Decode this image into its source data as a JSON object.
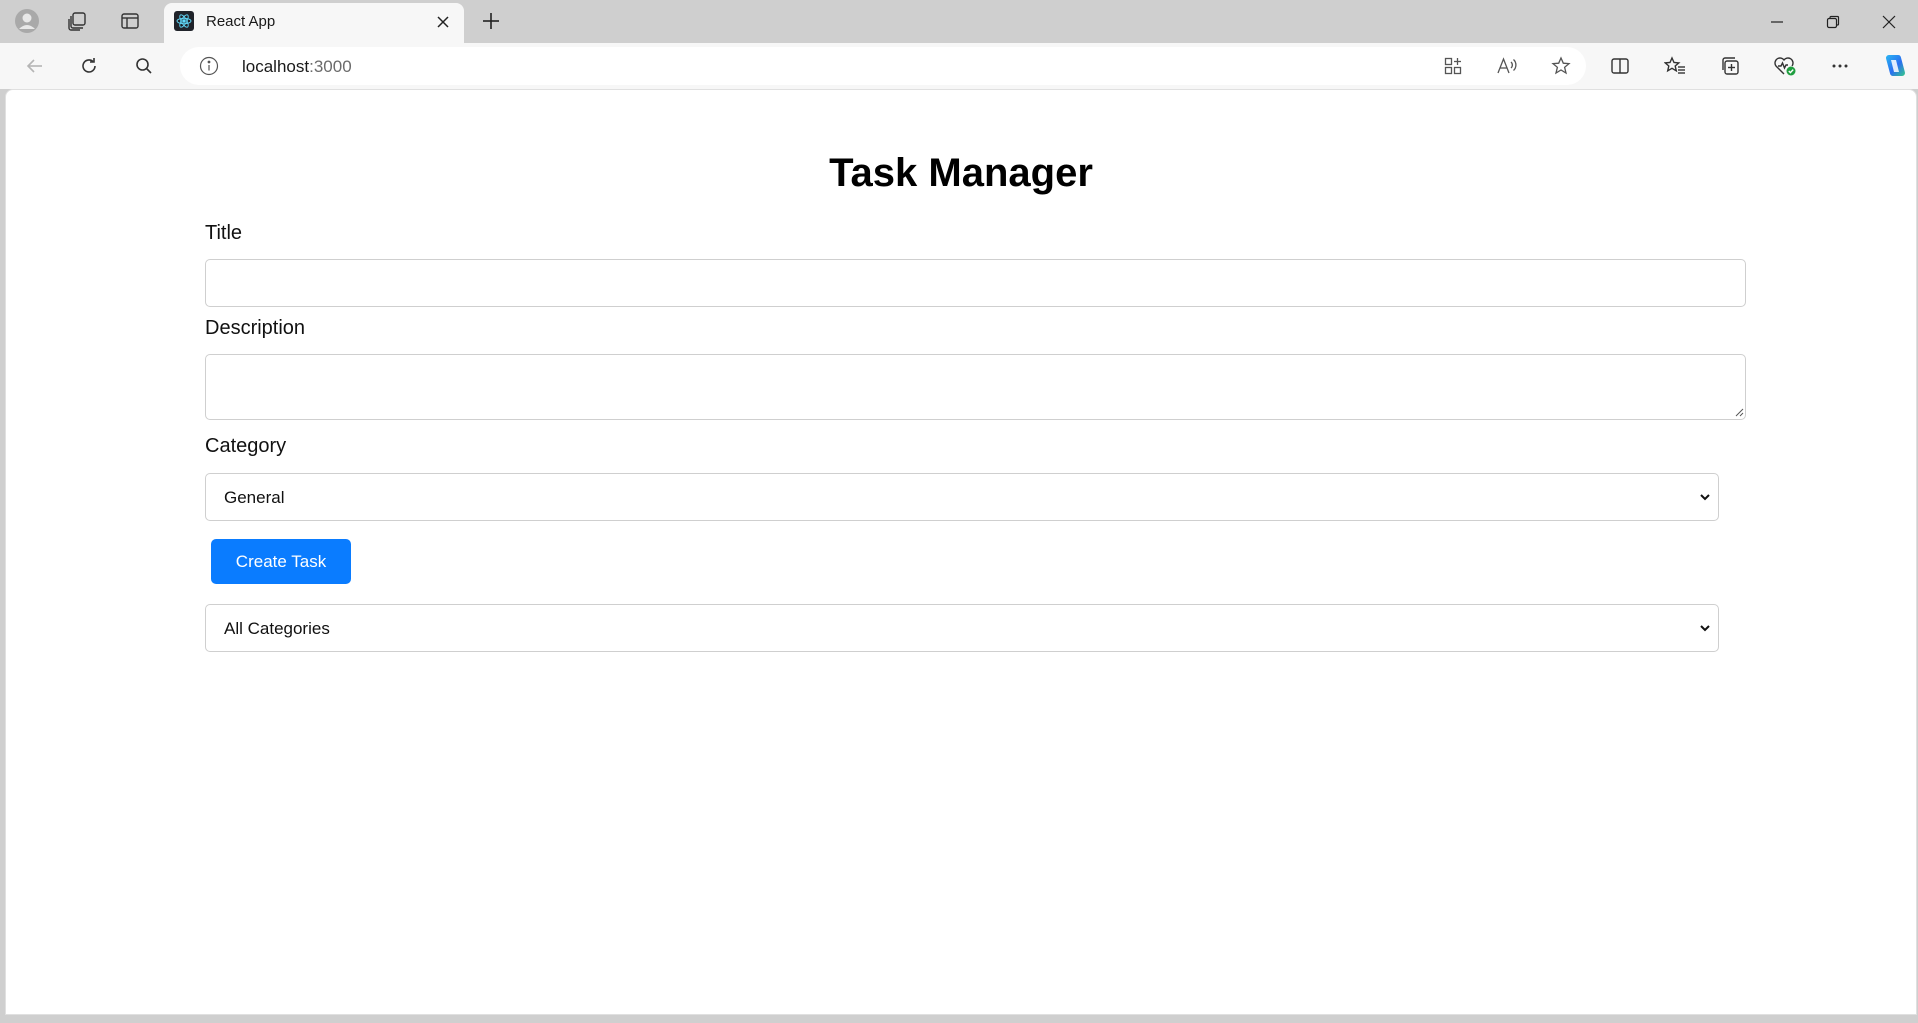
{
  "browser": {
    "tab_title": "React App",
    "url_host": "localhost",
    "url_port": ":3000"
  },
  "page": {
    "heading": "Task Manager",
    "title_label": "Title",
    "title_value": "",
    "description_label": "Description",
    "description_value": "",
    "category_label": "Category",
    "category_selected": "General",
    "create_button": "Create Task",
    "filter_selected": "All Categories"
  },
  "colors": {
    "primary_button": "#0a7cff",
    "page_background": "#ffffff",
    "chrome_background": "#cfcfcf"
  },
  "icons": {
    "profile": "profile-icon",
    "workspaces": "workspaces-icon",
    "tab_actions": "vertical-tabs-icon",
    "favicon": "react-logo-icon",
    "close_tab": "close-icon",
    "new_tab": "plus-icon",
    "back": "back-arrow-icon",
    "refresh": "refresh-icon",
    "search": "search-icon",
    "info": "info-icon",
    "apps": "apps-icon",
    "read_aloud": "read-aloud-icon",
    "favorite": "star-icon",
    "split": "split-screen-icon",
    "favorites": "favorites-icon",
    "collections": "collections-icon",
    "health": "browser-essentials-icon",
    "more": "more-icon",
    "copilot": "copilot-icon"
  }
}
